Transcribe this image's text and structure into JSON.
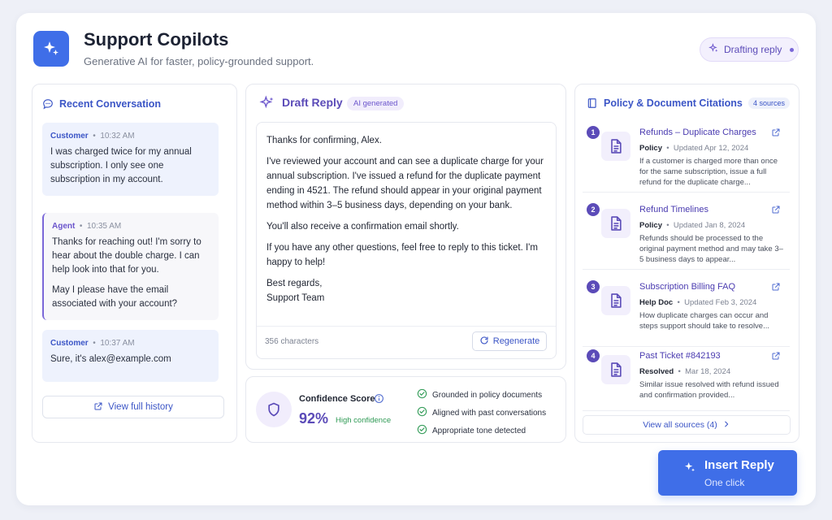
{
  "app": {
    "title": "Support Copilots",
    "subtitle": "Generative AI for faster, policy-grounded support.",
    "status": "Drafting reply"
  },
  "conversation": {
    "title": "Recent Conversation",
    "messages": [
      {
        "sender": "Customer",
        "time": "10:32 AM",
        "paragraphs": [
          "I was charged twice for my annual subscription. I only see one subscription in my account."
        ]
      },
      {
        "sender": "Agent",
        "time": "10:35 AM",
        "paragraphs": [
          "Thanks for reaching out! I'm sorry to hear about the double charge. I can help look into that for you.",
          "May I please have the email associated with your account?"
        ]
      },
      {
        "sender": "Customer",
        "time": "10:37 AM",
        "paragraphs": [
          "Sure, it's alex@example.com"
        ]
      }
    ],
    "history_label": "View full history"
  },
  "draft": {
    "title": "Draft Reply",
    "badge": "AI generated",
    "paragraphs": [
      "Thanks for confirming, Alex.",
      "I've reviewed your account and can see a duplicate charge for your annual subscription. I've issued a refund for the duplicate payment ending in 4521. The refund should appear in your original payment method within 3–5 business days, depending on your bank.",
      "You'll also receive a confirmation email shortly.",
      "If you have any other questions, feel free to reply to this ticket. I'm happy to help!",
      "Best regards,",
      "Support Team"
    ],
    "char_count": "356 characters",
    "regenerate_label": "Regenerate"
  },
  "confidence": {
    "label": "Confidence Score",
    "value": "92%",
    "level": "High confidence",
    "checks": [
      "Grounded in policy documents",
      "Aligned with past conversations",
      "Appropriate tone detected"
    ]
  },
  "citations": {
    "title": "Policy & Document Citations",
    "count_badge": "4 sources",
    "items": [
      {
        "num": "1",
        "title": "Refunds – Duplicate Charges",
        "type": "Policy",
        "updated": "Updated Apr 12, 2024",
        "excerpt": "If a customer is charged more than once for the same subscription, issue a full refund for the duplicate charge..."
      },
      {
        "num": "2",
        "title": "Refund Timelines",
        "type": "Policy",
        "updated": "Updated Jan 8, 2024",
        "excerpt": "Refunds should be processed to the original payment method and may take 3–5 business days to appear..."
      },
      {
        "num": "3",
        "title": "Subscription Billing FAQ",
        "type": "Help Doc",
        "updated": "Updated Feb 3, 2024",
        "excerpt": "How duplicate charges can occur and steps support should take to resolve..."
      },
      {
        "num": "4",
        "title": "Past Ticket #842193",
        "type": "Resolved",
        "updated": "Mar 18, 2024",
        "excerpt": "Similar issue resolved with refund issued and confirmation provided..."
      }
    ],
    "view_all_label": "View all sources (4)"
  },
  "insert": {
    "title": "Insert Reply",
    "subtitle": "One click"
  },
  "colors": {
    "primary": "#3f6ee8",
    "accent": "#5b4bb8",
    "success": "#2f9a55"
  }
}
